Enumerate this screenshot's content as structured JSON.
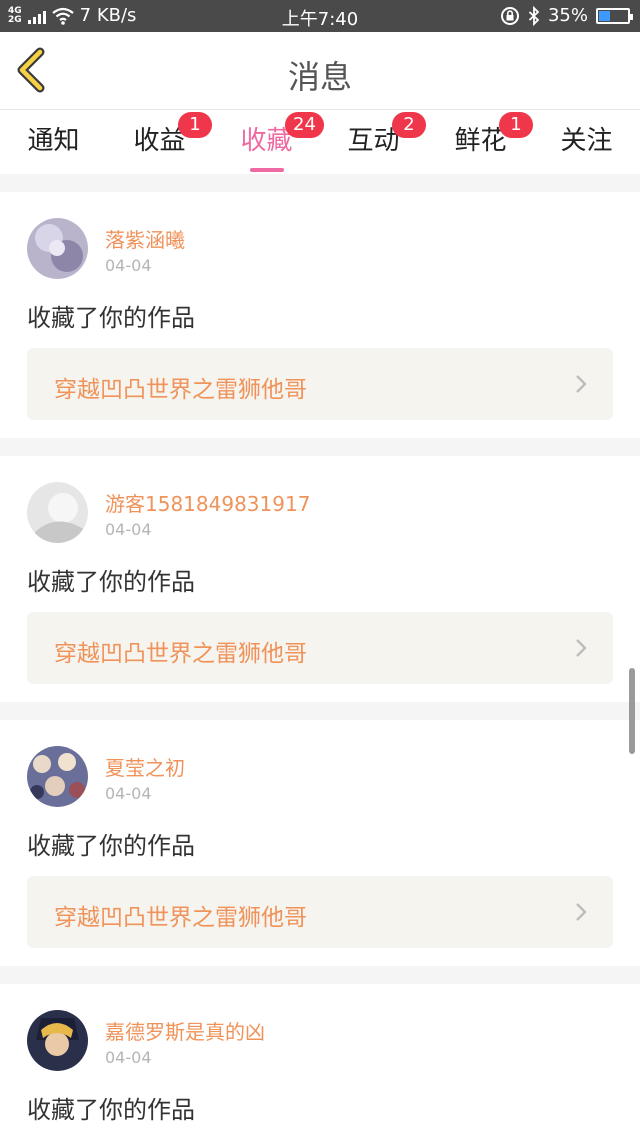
{
  "status_bar": {
    "network": "4G",
    "network2": "2G",
    "speed": "7 KB/s",
    "time": "上午7:40",
    "battery": "35%",
    "icons": [
      "signal-icon",
      "wifi-icon",
      "lock-rotation-icon",
      "bluetooth-icon",
      "battery-icon"
    ]
  },
  "header": {
    "title": "消息",
    "back_icon": "chevron-left-icon"
  },
  "tabs": [
    {
      "label": "通知",
      "badge": ""
    },
    {
      "label": "收益",
      "badge": "1"
    },
    {
      "label": "收藏",
      "badge": "24",
      "active": true
    },
    {
      "label": "互动",
      "badge": "2"
    },
    {
      "label": "鲜花",
      "badge": "1"
    },
    {
      "label": "关注",
      "badge": ""
    }
  ],
  "items": [
    {
      "user": "落紫涵曦",
      "date": "04-04",
      "action": "收藏了你的作品",
      "work": "穿越凹凸世界之雷狮他哥"
    },
    {
      "user": "游客1581849831917",
      "date": "04-04",
      "action": "收藏了你的作品",
      "work": "穿越凹凸世界之雷狮他哥"
    },
    {
      "user": "夏莹之初",
      "date": "04-04",
      "action": "收藏了你的作品",
      "work": "穿越凹凸世界之雷狮他哥"
    },
    {
      "user": "嘉德罗斯是真的凶",
      "date": "04-04",
      "action": "收藏了你的作品",
      "work": ""
    }
  ],
  "colors": {
    "accent": "#ef6aa2",
    "badge": "#f0364b",
    "username": "#f0935b",
    "work_bg": "#f6f4ef"
  }
}
